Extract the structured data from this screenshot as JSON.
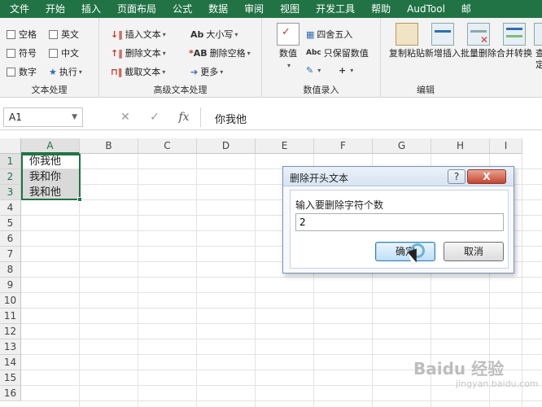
{
  "menu": [
    "文件",
    "开始",
    "插入",
    "页面布局",
    "公式",
    "数据",
    "审阅",
    "视图",
    "开发工具",
    "帮助",
    "AudTool",
    "邮"
  ],
  "ribbon": {
    "text_processing": {
      "items": [
        "空格",
        "英文",
        "符号",
        "中文",
        "数字",
        "执行"
      ],
      "label": "文本处理"
    },
    "advanced_text": {
      "col1": [
        "插入文本",
        "删除文本",
        "截取文本"
      ],
      "col2": [
        "大小写",
        "删除空格",
        "更多"
      ],
      "col2_icons": [
        "Ab",
        "AB"
      ],
      "label": "高级文本处理"
    },
    "numeric_entry": {
      "big": "数值",
      "col": [
        "四舍五入",
        "只保留数值"
      ],
      "col_icons": [
        "Abc"
      ],
      "label": "数值录入"
    },
    "edit": {
      "buttons": [
        "复制粘贴",
        "新增插入",
        "批量删除",
        "合并转换",
        "查找定位"
      ],
      "label": "编辑"
    }
  },
  "formula_bar": {
    "name_box": "A1",
    "content": "你我他"
  },
  "grid": {
    "columns": [
      "A",
      "B",
      "C",
      "D",
      "E",
      "F",
      "G",
      "H",
      "I"
    ],
    "rows": [
      "1",
      "2",
      "3",
      "4",
      "5",
      "6",
      "7",
      "8",
      "9",
      "10",
      "11",
      "12",
      "13",
      "14",
      "15",
      "16"
    ],
    "cells": [
      "你我他",
      "我和你",
      "我和他"
    ]
  },
  "dialog": {
    "title": "删除开头文本",
    "help": "?",
    "close": "X",
    "prompt": "输入要删除字符个数",
    "value": "2",
    "ok": "确定",
    "cancel": "取消"
  },
  "watermark": {
    "brand": "Baidu 经验",
    "url": "jingyan.baidu.com"
  }
}
